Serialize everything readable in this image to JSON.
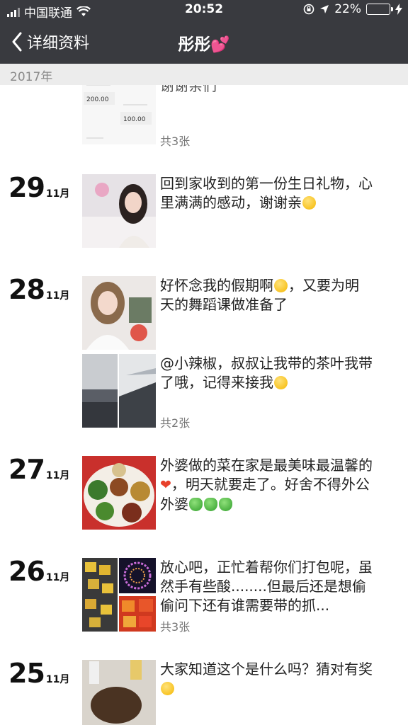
{
  "status_bar": {
    "carrier": "中国联通",
    "time": "20:52",
    "battery": "22%",
    "battery_level": 0.22
  },
  "nav": {
    "back_label": "详细资料",
    "title": "彤彤",
    "title_emoji": "💕"
  },
  "year_header": "2017年",
  "entries": [
    {
      "text": "谢谢亲们",
      "count": "共3张"
    },
    {
      "day": "29",
      "month": "11月",
      "text": "回到家收到的第一份生日礼物，心里满满的感动，谢谢亲"
    },
    {
      "day": "28",
      "month": "11月",
      "text": "好怀念我的假期啊 ，又要为明天的舞蹈课做准备了",
      "text_part1": "好怀念我的假期啊",
      "text_part2": "，又要为明天的舞蹈课做准备了"
    },
    {
      "text": "@小辣椒，叔叔让我带的茶叶我带了哦，记得来接我",
      "count": "共2张"
    },
    {
      "day": "27",
      "month": "11月",
      "text": "外婆做的菜在家是最美味最温馨的",
      "text_part2": "，明天就要走了。好舍不得外公外婆"
    },
    {
      "day": "26",
      "month": "11月",
      "text": "放心吧，正忙着帮你们打包呢，虽然手有些酸........但最后还是想偷偷问下还有谁需要带的抓...",
      "count": "共3张"
    },
    {
      "day": "25",
      "month": "11月",
      "text": "大家知道这个是什么吗？猜对有奖"
    }
  ],
  "colors": {
    "bar": "#393a3f",
    "year_bg": "#ececec",
    "heart": "#e94ba8"
  }
}
